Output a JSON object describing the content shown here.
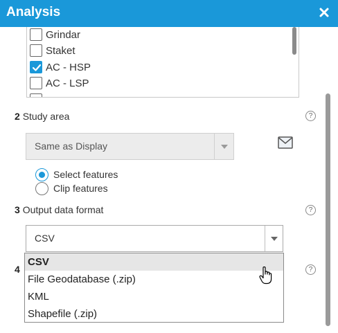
{
  "window": {
    "title": "Analysis"
  },
  "layers": {
    "items": [
      {
        "label": "Grindar",
        "checked": false
      },
      {
        "label": "Staket",
        "checked": false
      },
      {
        "label": "AC - HSP",
        "checked": true
      },
      {
        "label": "AC - LSP",
        "checked": false
      }
    ]
  },
  "study_area": {
    "number": "2",
    "label": "Study area",
    "select_value": "Same as Display",
    "options": [
      {
        "label": "Select features",
        "selected": true
      },
      {
        "label": "Clip features",
        "selected": false
      }
    ]
  },
  "output_format": {
    "number": "3",
    "label": "Output data format",
    "select_value": "CSV",
    "dropdown_options": [
      "CSV",
      "File Geodatabase (.zip)",
      "KML",
      "Shapefile (.zip)"
    ]
  },
  "section4": {
    "number": "4"
  },
  "icons": {
    "help": "?",
    "accent": "#1a98d9"
  }
}
